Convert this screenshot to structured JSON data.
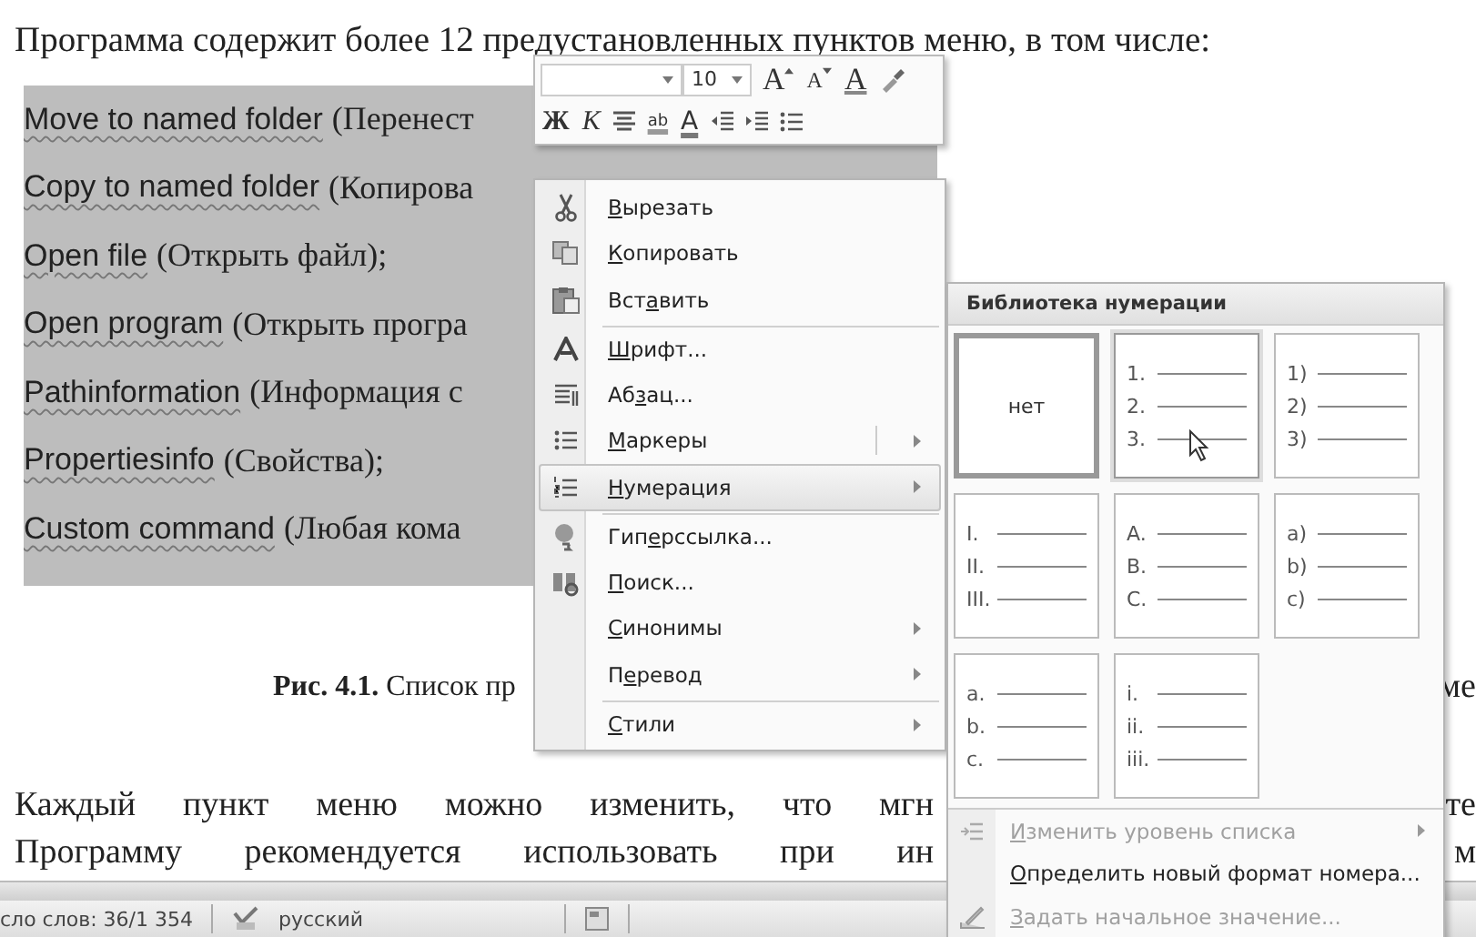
{
  "document": {
    "intro": "Программа содержит более 12 предустановленных пунктов меню, в том числе:",
    "selected_lines": [
      {
        "name": "Move to named folder",
        "note": "(Перенест"
      },
      {
        "name": "Copy to named folder",
        "note": "(Копирова"
      },
      {
        "name": "Open file",
        "note": "(Открыть файл);"
      },
      {
        "name": "Open program",
        "note": "(Открыть програ"
      },
      {
        "name": "Pathinformation",
        "note": "(Информация с"
      },
      {
        "name": "Propertiesinfo",
        "note": "(Свойства);"
      },
      {
        "name": "Custom command",
        "note": "(Любая кома"
      }
    ],
    "caption": {
      "text": "**Рис. 4.1.** Список пр",
      "tail": "ме"
    },
    "paragraph": [
      {
        "text": "Каждый пункт меню можно изменить, что мгн",
        "tail": "те"
      },
      {
        "text": "Программу рекомендуется использовать при ин",
        "tail": "м"
      }
    ]
  },
  "mini_toolbar": {
    "font_size": "10",
    "row1": [
      {
        "kind": "grow",
        "label": "A"
      },
      {
        "kind": "shrink",
        "label": "A"
      },
      {
        "kind": "styles",
        "label": "A"
      },
      {
        "kind": "painter"
      }
    ],
    "row2": [
      {
        "kind": "bold",
        "label": "Ж"
      },
      {
        "kind": "italic",
        "label": "К"
      },
      {
        "kind": "center"
      },
      {
        "kind": "highlight",
        "label": "ab"
      },
      {
        "kind": "color",
        "label": "A"
      },
      {
        "kind": "outdent"
      },
      {
        "kind": "indent"
      },
      {
        "kind": "bullets"
      }
    ]
  },
  "context_menu": {
    "items": [
      {
        "key": "В",
        "after": "ырезать",
        "submenu": false,
        "selected": false,
        "separator_before": false
      },
      {
        "key": "К",
        "after": "опировать",
        "submenu": false,
        "selected": false,
        "separator_before": false
      },
      {
        "before": "Вст",
        "key": "а",
        "after": "вить",
        "submenu": false,
        "selected": false,
        "separator_before": false
      },
      {
        "key": "Ш",
        "after": "рифт...",
        "submenu": false,
        "selected": false,
        "separator_before": true
      },
      {
        "before": "Аб",
        "key": "з",
        "after": "ац...",
        "submenu": false,
        "selected": false,
        "separator_before": false
      },
      {
        "key": "М",
        "after": "аркеры",
        "submenu": true,
        "selected": false,
        "separator_before": false
      },
      {
        "key": "Н",
        "after": "умерация",
        "submenu": true,
        "selected": true,
        "separator_before": false
      },
      {
        "before": "Гип",
        "key": "е",
        "after": "рссылка...",
        "submenu": false,
        "selected": false,
        "separator_before": true
      },
      {
        "key": "П",
        "after": "оиск...",
        "submenu": false,
        "selected": false,
        "separator_before": false
      },
      {
        "key": "С",
        "after": "инонимы",
        "submenu": true,
        "selected": false,
        "separator_before": false
      },
      {
        "before": "П",
        "key": "е",
        "after": "ревод",
        "submenu": true,
        "selected": false,
        "separator_before": false
      },
      {
        "key": "С",
        "after": "тили",
        "submenu": true,
        "selected": false,
        "separator_before": true
      }
    ]
  },
  "numbering_menu": {
    "title": "Библиотека нумерации",
    "tiles": [
      {
        "kind": "none",
        "label": "нет",
        "selected": true,
        "hovered": false
      },
      {
        "kind": "list",
        "markers": [
          "1.",
          "2.",
          "3."
        ],
        "selected": false,
        "hovered": true
      },
      {
        "kind": "list",
        "markers": [
          "1)",
          "2)",
          "3)"
        ],
        "selected": false,
        "hovered": false
      },
      {
        "kind": "list",
        "markers": [
          "I.",
          "II.",
          "III."
        ],
        "selected": false,
        "hovered": false
      },
      {
        "kind": "list",
        "markers": [
          "A.",
          "B.",
          "C."
        ],
        "selected": false,
        "hovered": false
      },
      {
        "kind": "list",
        "markers": [
          "a)",
          "b)",
          "c)"
        ],
        "selected": false,
        "hovered": false
      },
      {
        "kind": "list",
        "markers": [
          "a.",
          "b.",
          "c."
        ],
        "selected": false,
        "hovered": false
      },
      {
        "kind": "list",
        "markers": [
          "i.",
          "ii.",
          "iii."
        ],
        "selected": false,
        "hovered": false
      }
    ],
    "items": [
      {
        "key": "И",
        "after": "зменить уровень списка",
        "disabled": true,
        "submenu": true
      },
      {
        "key": "О",
        "after": "пределить новый формат номера...",
        "disabled": false,
        "submenu": false
      },
      {
        "key": "З",
        "after": "адать начальное значение...",
        "disabled": true,
        "submenu": false
      }
    ]
  },
  "status_bar": {
    "word_count": "сло слов: 36/1 354",
    "language": "русский"
  }
}
